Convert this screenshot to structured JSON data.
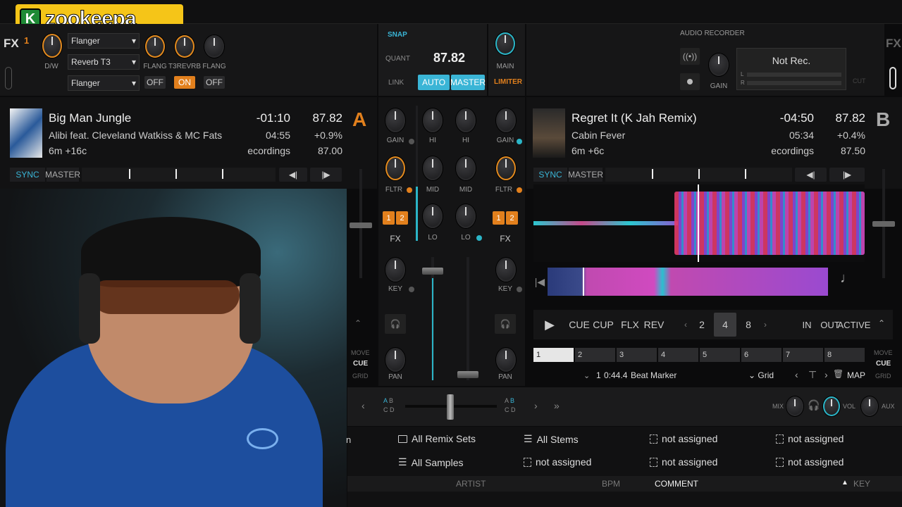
{
  "logo": {
    "letter": "K",
    "text": "zookeepa"
  },
  "fx_left": {
    "label": "FX",
    "unit_num": "1",
    "dw_label": "D/W",
    "effects": [
      "Flanger",
      "Reverb T3",
      "Flanger"
    ],
    "knob_labels": [
      "FLANG",
      "T3REVRB",
      "FLANG"
    ],
    "toggles": [
      "OFF",
      "ON",
      "OFF"
    ]
  },
  "fx_right": {
    "label": "FX"
  },
  "master": {
    "snap": "SNAP",
    "quant": "QUANT",
    "link": "LINK",
    "bpm": "87.82",
    "auto": "AUTO",
    "master": "MASTER",
    "main": "MAIN",
    "limiter": "LIMITER"
  },
  "recorder": {
    "title": "AUDIO RECORDER",
    "status": "Not Rec.",
    "gain": "GAIN",
    "l": "L",
    "r": "R",
    "cut": "CUT"
  },
  "deck_a": {
    "letter": "A",
    "title": "Big Man Jungle",
    "artist": "Alibi feat. Cleveland Watkiss & MC Fats",
    "key": "6m +16c",
    "remaining": "-01:10",
    "total": "04:55",
    "comment": "ecordings",
    "bpm": "87.82",
    "pitch": "+0.9%",
    "base_bpm": "87.00",
    "sync": "SYNC",
    "master": "MASTER"
  },
  "deck_b": {
    "letter": "B",
    "title": "Regret It (K Jah Remix)",
    "artist": "Cabin Fever",
    "key": "6m +6c",
    "remaining": "-04:50",
    "total": "05:34",
    "comment": "ecordings",
    "bpm": "87.82",
    "pitch": "+0.4%",
    "base_bpm": "87.50",
    "sync": "SYNC",
    "master": "MASTER",
    "transport": {
      "cue": "CUE",
      "cup": "CUP",
      "flx": "FLX",
      "rev": "REV",
      "loops": [
        "2",
        "4",
        "8"
      ],
      "in": "IN",
      "out": "OUT",
      "active": "ACTIVE"
    },
    "cues": [
      "1",
      "2",
      "3",
      "4",
      "5",
      "6",
      "7",
      "8"
    ],
    "cue_info": {
      "index": "1",
      "time": "0:44.4",
      "name": "Beat Marker",
      "type": "Grid",
      "map": "MAP"
    }
  },
  "mixer": {
    "gain": "GAIN",
    "hi": "HI",
    "mid": "MID",
    "lo": "LO",
    "fltr": "FLTR",
    "fx": "FX",
    "key": "KEY",
    "pan": "PAN",
    "fx_assign": [
      "1",
      "2"
    ],
    "move": "MOVE",
    "cue": "CUE",
    "grid": "GRID"
  },
  "crossfader": {
    "a": "A",
    "b": "B",
    "c": "C",
    "d": "D"
  },
  "cue_mix": {
    "mix": "MIX",
    "vol": "VOL",
    "aux": "AUX"
  },
  "browser": {
    "row1": [
      "All Remix Sets",
      "All Stems",
      "not assigned",
      "not assigned"
    ],
    "row2": [
      "All Samples",
      "not assigned",
      "not assigned",
      "not assigned"
    ],
    "columns": [
      "ARTIST",
      "BPM",
      "COMMENT",
      "KEY"
    ],
    "partial": "n"
  },
  "colors": {
    "orange": "#e2801d",
    "blue": "#3ab5d6",
    "teal": "#2bb5c7",
    "bg": "#0b0b0c"
  }
}
